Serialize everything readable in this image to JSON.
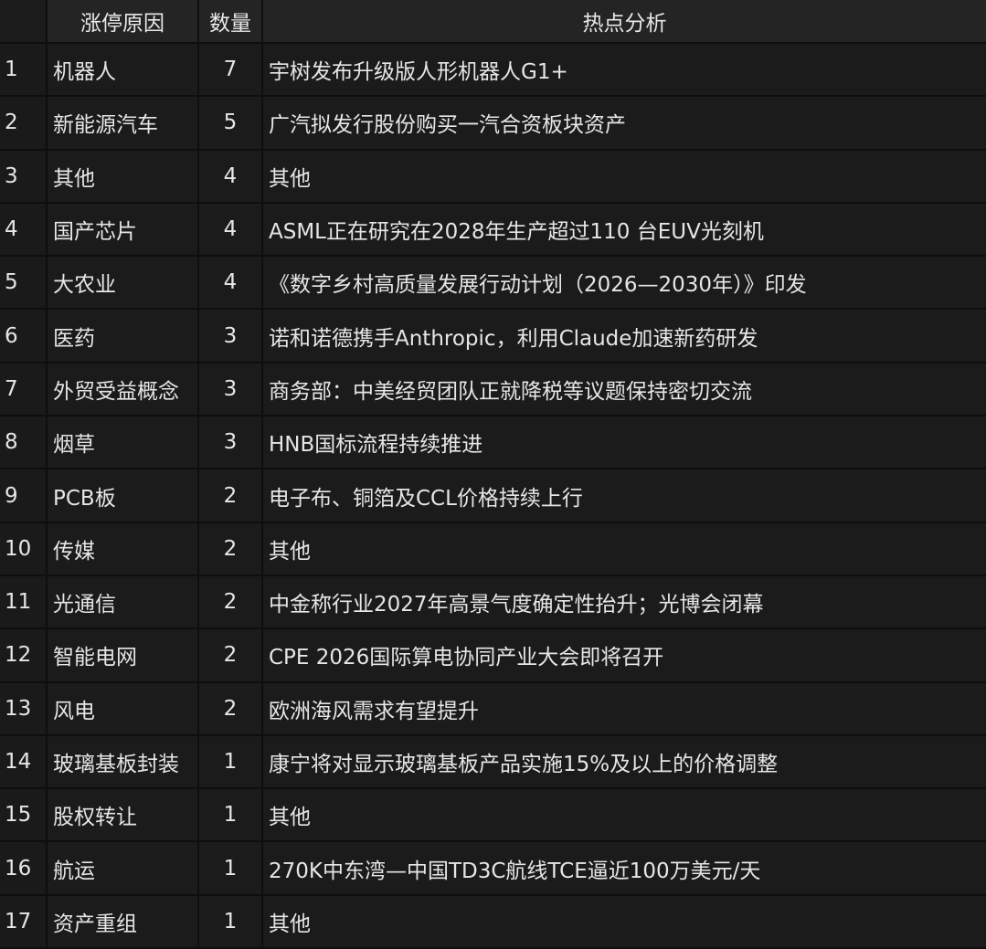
{
  "headers": {
    "index": "",
    "reason": "涨停原因",
    "count": "数量",
    "analysis": "热点分析"
  },
  "rows": [
    {
      "idx": "1",
      "reason": "机器人",
      "count": "7",
      "analysis": "宇树发布升级版人形机器人G1+"
    },
    {
      "idx": "2",
      "reason": "新能源汽车",
      "count": "5",
      "analysis": "广汽拟发行股份购买一汽合资板块资产"
    },
    {
      "idx": "3",
      "reason": "其他",
      "count": "4",
      "analysis": "其他"
    },
    {
      "idx": "4",
      "reason": "国产芯片",
      "count": "4",
      "analysis": "ASML正在研究在2028年生产超过110 台EUV光刻机"
    },
    {
      "idx": "5",
      "reason": "大农业",
      "count": "4",
      "analysis": "《数字乡村高质量发展行动计划（2026—2030年）》印发"
    },
    {
      "idx": "6",
      "reason": "医药",
      "count": "3",
      "analysis": "诺和诺德携手Anthropic，利用Claude加速新药研发"
    },
    {
      "idx": "7",
      "reason": "外贸受益概念",
      "count": "3",
      "analysis": "商务部：中美经贸团队正就降税等议题保持密切交流"
    },
    {
      "idx": "8",
      "reason": "烟草",
      "count": "3",
      "analysis": "HNB国标流程持续推进"
    },
    {
      "idx": "9",
      "reason": "PCB板",
      "count": "2",
      "analysis": "电子布、铜箔及CCL价格持续上行"
    },
    {
      "idx": "10",
      "reason": "传媒",
      "count": "2",
      "analysis": "其他"
    },
    {
      "idx": "11",
      "reason": "光通信",
      "count": "2",
      "analysis": "中金称行业2027年高景气度确定性抬升；光博会闭幕"
    },
    {
      "idx": "12",
      "reason": "智能电网",
      "count": "2",
      "analysis": "CPE 2026国际算电协同产业大会即将召开"
    },
    {
      "idx": "13",
      "reason": "风电",
      "count": "2",
      "analysis": "欧洲海风需求有望提升"
    },
    {
      "idx": "14",
      "reason": "玻璃基板封装",
      "count": "1",
      "analysis": "康宁将对显示玻璃基板产品实施15%及以上的价格调整"
    },
    {
      "idx": "15",
      "reason": "股权转让",
      "count": "1",
      "analysis": "其他"
    },
    {
      "idx": "16",
      "reason": "航运",
      "count": "1",
      "analysis": "270K中东湾—中国TD3C航线TCE逼近100万美元/天"
    },
    {
      "idx": "17",
      "reason": "资产重组",
      "count": "1",
      "analysis": "其他"
    }
  ]
}
